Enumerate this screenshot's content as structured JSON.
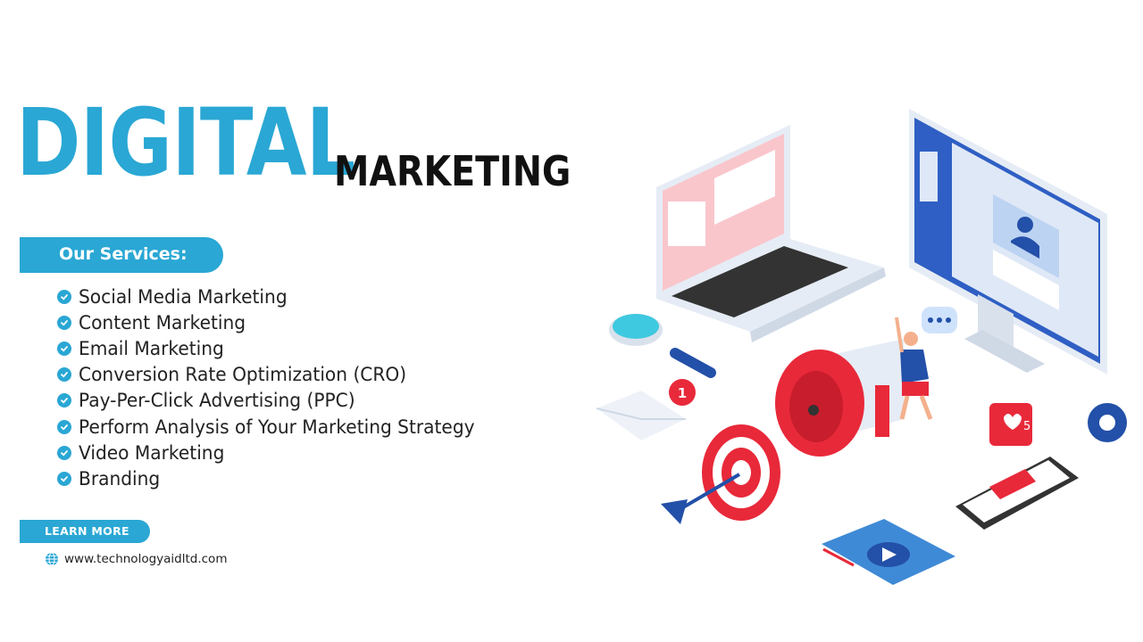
{
  "headline": {
    "primary": "DIGITAL",
    "secondary": "MARKETING"
  },
  "services": {
    "heading": "Our Services:",
    "items": [
      "Social Media Marketing",
      "Content Marketing",
      "Email Marketing",
      "Conversion Rate Optimization (CRO)",
      "Pay-Per-Click Advertising (PPC)",
      "Perform Analysis of Your Marketing Strategy",
      "Video Marketing",
      "Branding"
    ]
  },
  "cta": {
    "label": "LEARN MORE"
  },
  "footer": {
    "website": "www.technologyaidltd.com"
  },
  "illustration": {
    "notification_badge": "1",
    "likes_count": "5"
  },
  "colors": {
    "accent": "#2aa7d4",
    "headline_dark": "#111111",
    "red": "#e8293a",
    "navy": "#2350a8"
  }
}
